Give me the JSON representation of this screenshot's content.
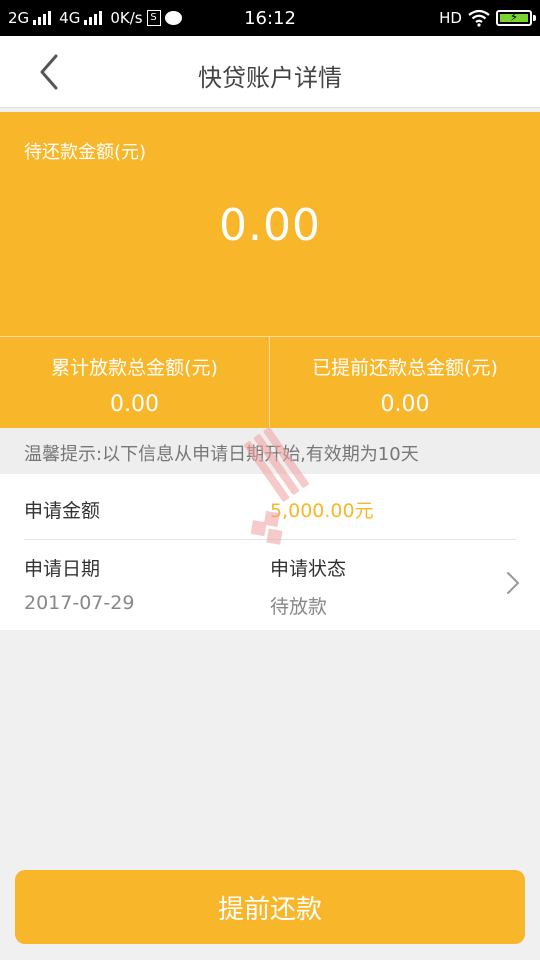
{
  "status_bar": {
    "network_2g": "2G",
    "network_4g": "4G",
    "speed": "0K/s",
    "sim_label": "S",
    "time": "16:12",
    "hd": "HD",
    "battery_bolt": "⚡"
  },
  "header": {
    "title": "快贷账户详情"
  },
  "summary": {
    "pending_label": "待还款金额(元)",
    "pending_amount": "0.00",
    "total_disbursed_label": "累计放款总金额(元)",
    "total_disbursed_value": "0.00",
    "total_prepaid_label": "已提前还款总金额(元)",
    "total_prepaid_value": "0.00"
  },
  "tip": {
    "text": "温馨提示:以下信息从申请日期开始,有效期为10天"
  },
  "application": {
    "amount_label": "申请金额",
    "amount_value": "5,000.00元",
    "date_label": "申请日期",
    "date_value": "2017-07-29",
    "status_label": "申请状态",
    "status_value": "待放款"
  },
  "action": {
    "prepay_label": "提前还款"
  },
  "colors": {
    "accent": "#f8b72a",
    "background": "#f0f0f0"
  }
}
